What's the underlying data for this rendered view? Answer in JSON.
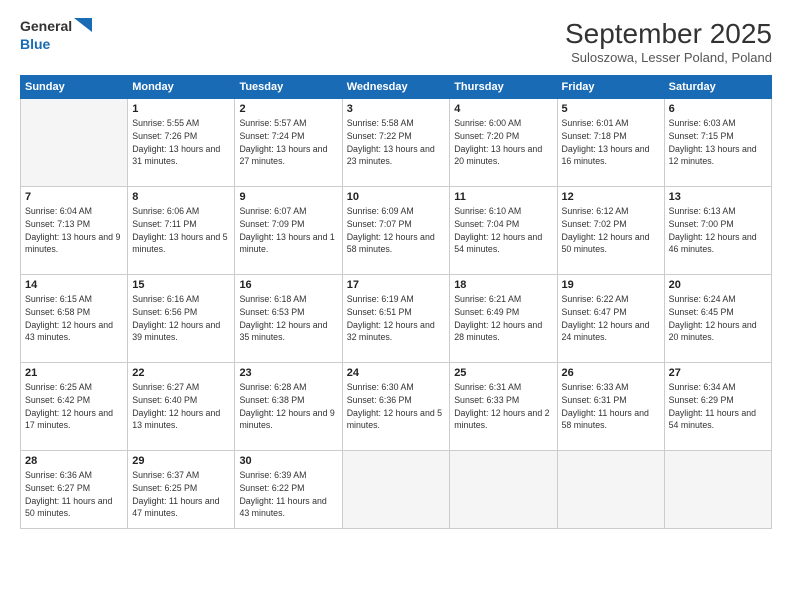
{
  "logo": {
    "line1": "General",
    "line2": "Blue"
  },
  "title": "September 2025",
  "subtitle": "Suloszowa, Lesser Poland, Poland",
  "days_header": [
    "Sunday",
    "Monday",
    "Tuesday",
    "Wednesday",
    "Thursday",
    "Friday",
    "Saturday"
  ],
  "weeks": [
    [
      {
        "day": "",
        "empty": true
      },
      {
        "day": "1",
        "sunrise": "5:55 AM",
        "sunset": "7:26 PM",
        "daylight": "13 hours and 31 minutes."
      },
      {
        "day": "2",
        "sunrise": "5:57 AM",
        "sunset": "7:24 PM",
        "daylight": "13 hours and 27 minutes."
      },
      {
        "day": "3",
        "sunrise": "5:58 AM",
        "sunset": "7:22 PM",
        "daylight": "13 hours and 23 minutes."
      },
      {
        "day": "4",
        "sunrise": "6:00 AM",
        "sunset": "7:20 PM",
        "daylight": "13 hours and 20 minutes."
      },
      {
        "day": "5",
        "sunrise": "6:01 AM",
        "sunset": "7:18 PM",
        "daylight": "13 hours and 16 minutes."
      },
      {
        "day": "6",
        "sunrise": "6:03 AM",
        "sunset": "7:15 PM",
        "daylight": "13 hours and 12 minutes."
      }
    ],
    [
      {
        "day": "7",
        "sunrise": "6:04 AM",
        "sunset": "7:13 PM",
        "daylight": "13 hours and 9 minutes."
      },
      {
        "day": "8",
        "sunrise": "6:06 AM",
        "sunset": "7:11 PM",
        "daylight": "13 hours and 5 minutes."
      },
      {
        "day": "9",
        "sunrise": "6:07 AM",
        "sunset": "7:09 PM",
        "daylight": "13 hours and 1 minute."
      },
      {
        "day": "10",
        "sunrise": "6:09 AM",
        "sunset": "7:07 PM",
        "daylight": "12 hours and 58 minutes."
      },
      {
        "day": "11",
        "sunrise": "6:10 AM",
        "sunset": "7:04 PM",
        "daylight": "12 hours and 54 minutes."
      },
      {
        "day": "12",
        "sunrise": "6:12 AM",
        "sunset": "7:02 PM",
        "daylight": "12 hours and 50 minutes."
      },
      {
        "day": "13",
        "sunrise": "6:13 AM",
        "sunset": "7:00 PM",
        "daylight": "12 hours and 46 minutes."
      }
    ],
    [
      {
        "day": "14",
        "sunrise": "6:15 AM",
        "sunset": "6:58 PM",
        "daylight": "12 hours and 43 minutes."
      },
      {
        "day": "15",
        "sunrise": "6:16 AM",
        "sunset": "6:56 PM",
        "daylight": "12 hours and 39 minutes."
      },
      {
        "day": "16",
        "sunrise": "6:18 AM",
        "sunset": "6:53 PM",
        "daylight": "12 hours and 35 minutes."
      },
      {
        "day": "17",
        "sunrise": "6:19 AM",
        "sunset": "6:51 PM",
        "daylight": "12 hours and 32 minutes."
      },
      {
        "day": "18",
        "sunrise": "6:21 AM",
        "sunset": "6:49 PM",
        "daylight": "12 hours and 28 minutes."
      },
      {
        "day": "19",
        "sunrise": "6:22 AM",
        "sunset": "6:47 PM",
        "daylight": "12 hours and 24 minutes."
      },
      {
        "day": "20",
        "sunrise": "6:24 AM",
        "sunset": "6:45 PM",
        "daylight": "12 hours and 20 minutes."
      }
    ],
    [
      {
        "day": "21",
        "sunrise": "6:25 AM",
        "sunset": "6:42 PM",
        "daylight": "12 hours and 17 minutes."
      },
      {
        "day": "22",
        "sunrise": "6:27 AM",
        "sunset": "6:40 PM",
        "daylight": "12 hours and 13 minutes."
      },
      {
        "day": "23",
        "sunrise": "6:28 AM",
        "sunset": "6:38 PM",
        "daylight": "12 hours and 9 minutes."
      },
      {
        "day": "24",
        "sunrise": "6:30 AM",
        "sunset": "6:36 PM",
        "daylight": "12 hours and 5 minutes."
      },
      {
        "day": "25",
        "sunrise": "6:31 AM",
        "sunset": "6:33 PM",
        "daylight": "12 hours and 2 minutes."
      },
      {
        "day": "26",
        "sunrise": "6:33 AM",
        "sunset": "6:31 PM",
        "daylight": "11 hours and 58 minutes."
      },
      {
        "day": "27",
        "sunrise": "6:34 AM",
        "sunset": "6:29 PM",
        "daylight": "11 hours and 54 minutes."
      }
    ],
    [
      {
        "day": "28",
        "sunrise": "6:36 AM",
        "sunset": "6:27 PM",
        "daylight": "11 hours and 50 minutes."
      },
      {
        "day": "29",
        "sunrise": "6:37 AM",
        "sunset": "6:25 PM",
        "daylight": "11 hours and 47 minutes."
      },
      {
        "day": "30",
        "sunrise": "6:39 AM",
        "sunset": "6:22 PM",
        "daylight": "11 hours and 43 minutes."
      },
      {
        "day": "",
        "empty": true
      },
      {
        "day": "",
        "empty": true
      },
      {
        "day": "",
        "empty": true
      },
      {
        "day": "",
        "empty": true
      }
    ]
  ]
}
